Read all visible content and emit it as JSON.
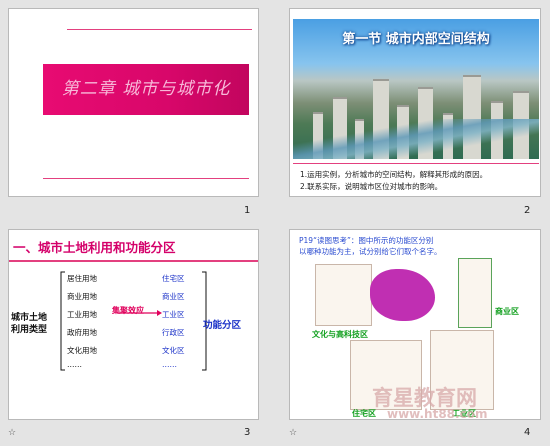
{
  "slides": [
    {
      "number": "1",
      "title": "第二章 城市与城市化"
    },
    {
      "number": "2",
      "caption": "第一节 城市内部空间结构",
      "notes": [
        "1.运用实例，分析城市的空间结构，解释其形成的原因。",
        "2.联系实际，说明城市区位对城市的影响。"
      ]
    },
    {
      "number": "3",
      "heading": "一、城市土地利用和功能分区",
      "left_label": [
        "城市土地",
        "利用类型"
      ],
      "land_uses": [
        "居住用地",
        "商业用地",
        "工业用地",
        "政府用地",
        "文化用地",
        "……"
      ],
      "arrow_label": "集聚效应",
      "zones": [
        "住宅区",
        "商业区",
        "工业区",
        "行政区",
        "文化区",
        "……"
      ],
      "right_label": "功能分区"
    },
    {
      "number": "4",
      "question": [
        "P19“读图思考”：图中所示的功能区分别",
        "以哪种功能为主，试分别给它们取个名字。"
      ],
      "labels": {
        "culture": "文化与高科技区",
        "commercial": "商业区",
        "residential": "住宅区",
        "industrial": "工业区"
      }
    }
  ],
  "footer": {
    "star": "☆",
    "watermark_cn": "育星教育网",
    "watermark_url": "www.ht88.com"
  },
  "colors": {
    "accent": "#e3407f",
    "title_pink": "#e80b72",
    "blue": "#1b32c8",
    "green": "#12a01f"
  }
}
